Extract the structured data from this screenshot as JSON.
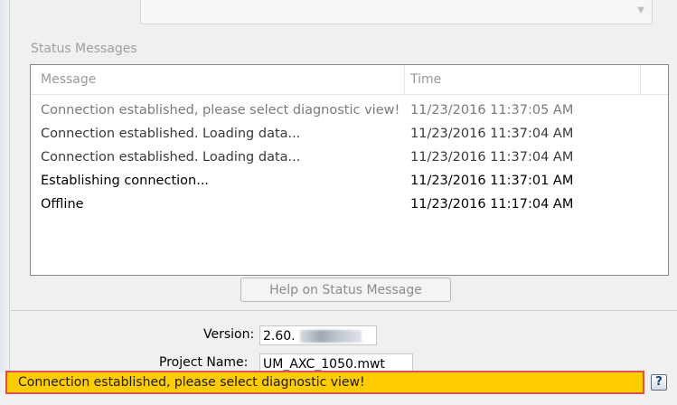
{
  "top_field": {
    "label": "",
    "value": ""
  },
  "status_messages": {
    "group_label": "Status Messages",
    "columns": {
      "message": "Message",
      "time": "Time"
    },
    "rows": [
      {
        "message": "Connection established, please select diagnostic view!",
        "time": "11/23/2016 11:37:05 AM",
        "color": "#7a7a7a"
      },
      {
        "message": "Connection established. Loading data...",
        "time": "11/23/2016 11:37:04 AM",
        "color": "#3a3a3a"
      },
      {
        "message": "Connection established. Loading data...",
        "time": "11/23/2016 11:37:04 AM",
        "color": "#3a3a3a"
      },
      {
        "message": "Establishing connection...",
        "time": "11/23/2016 11:37:01 AM",
        "color": "#000000"
      },
      {
        "message": "Offline",
        "time": "11/23/2016 11:17:04 AM",
        "color": "#000000"
      }
    ]
  },
  "help_button": {
    "label": "Help on Status Message"
  },
  "version": {
    "label": "Version:",
    "value": "2.60."
  },
  "project": {
    "label": "Project Name:",
    "value": "UM_AXC_1050.mwt"
  },
  "statusbar": {
    "text": "Connection established, please select diagnostic view!",
    "background": "#ffcc00",
    "border": "#d9534f"
  },
  "help_icon": {
    "glyph": "?",
    "name": "help-icon"
  }
}
